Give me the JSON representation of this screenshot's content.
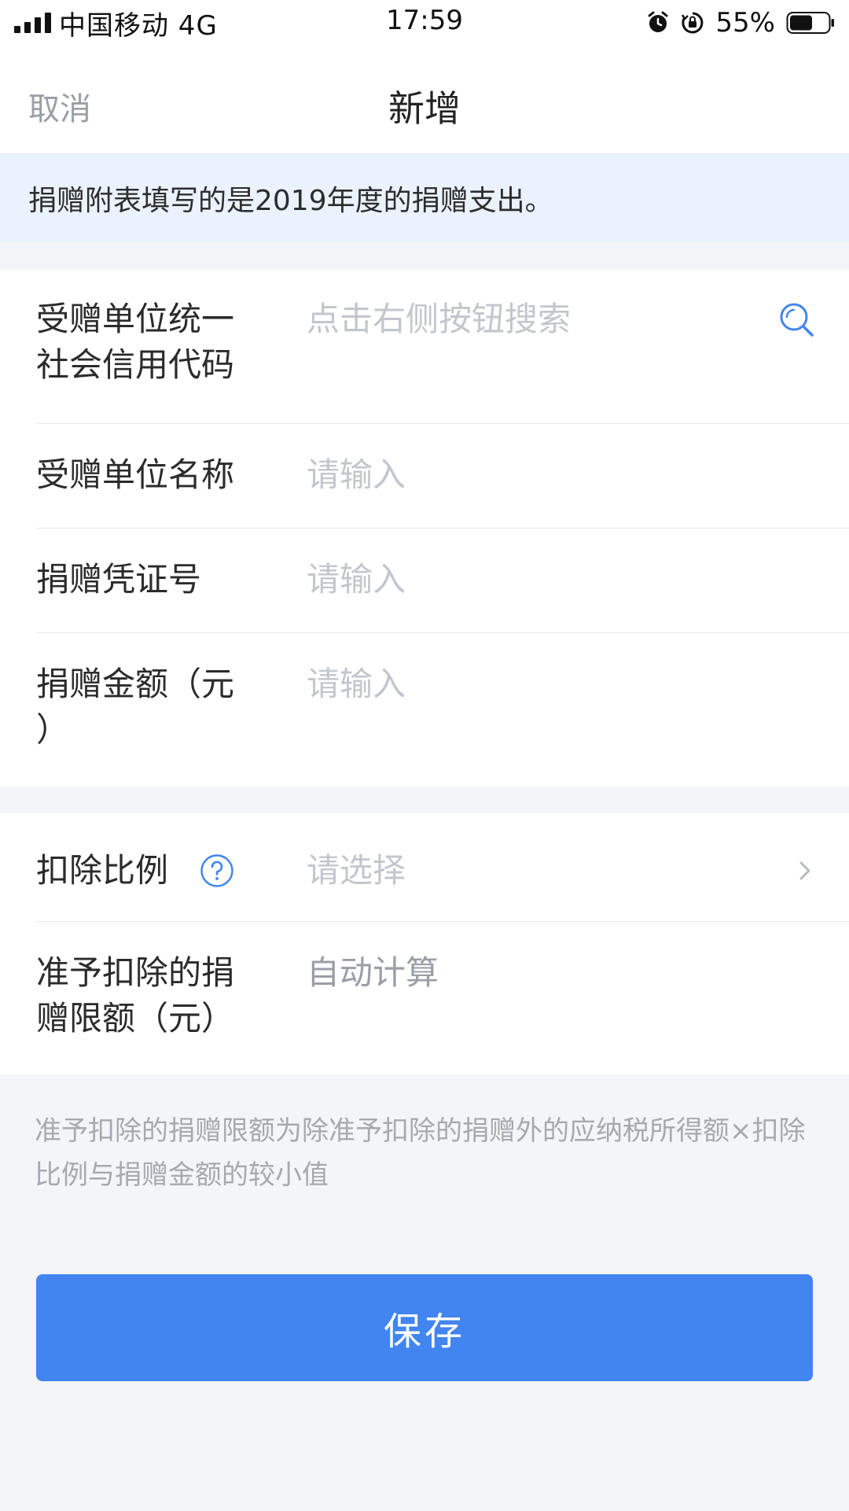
{
  "status_bar": {
    "carrier": "中国移动 4G",
    "time": "17:59",
    "battery": "55%",
    "icons": [
      "signal-icon",
      "alarm-icon",
      "orientation-lock-icon",
      "battery-icon"
    ]
  },
  "nav": {
    "cancel": "取消",
    "title": "新增"
  },
  "notice": "捐赠附表填写的是2019年度的捐赠支出。",
  "form": {
    "credit_code": {
      "label_line1": "受赠单位统一",
      "label_line2": "社会信用代码",
      "placeholder": "点击右侧按钮搜索",
      "icon": "search-icon"
    },
    "org_name": {
      "label": "受赠单位名称",
      "placeholder": "请输入"
    },
    "voucher_no": {
      "label": "捐赠凭证号",
      "placeholder": "请输入"
    },
    "amount": {
      "label_line1": "捐赠金额（元",
      "label_line2": "）",
      "placeholder": "请输入"
    },
    "ratio": {
      "label": "扣除比例",
      "placeholder": "请选择",
      "help_icon": "help-icon",
      "chevron": "chevron-right-icon"
    },
    "limit": {
      "label_line1": "准予扣除的捐",
      "label_line2": "赠限额（元）",
      "value": "自动计算"
    }
  },
  "footnote": "准予扣除的捐赠限额为除准予扣除的捐赠外的应纳税所得额×扣除比例与捐赠金额的较小值",
  "save_button": "保存",
  "colors": {
    "accent": "#4285f0",
    "notice_bg": "#eaf2fd",
    "page_bg": "#f3f5f8",
    "placeholder": "#c3c6cc"
  }
}
